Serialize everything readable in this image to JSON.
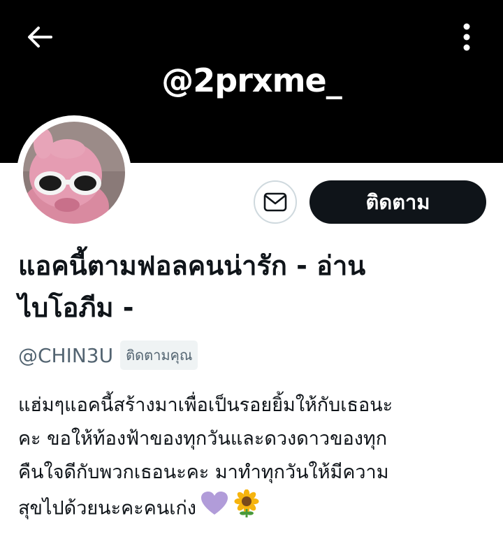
{
  "header": {
    "back_icon": "arrow-left-icon",
    "menu_icon": "more-vertical-icon",
    "banner_text": "@2prxme_",
    "banner_color": "#000000"
  },
  "actions": {
    "message_icon": "envelope-icon",
    "follow_label": "ติดตาม"
  },
  "profile": {
    "display_name_line1": "แอคนี้ตามฟอลคนน่ารัก - อ่าน",
    "display_name_line2": "ไบโอภีม -",
    "handle": "@CHIN3U",
    "follows_you_badge": "ติดตามคุณ",
    "bio": {
      "line1": "แฮ่มๆแอคนี้สร้างมาเพื่อเป็นรอยยิ้มให้กับเธอนะ",
      "line2": "คะ ขอให้ท้องฟ้าของทุกวันและดวงดาวของทุก",
      "line3": "คืนใจดีกับพวกเธอนะคะ มาทำทุกวันให้มีความ",
      "line4": "สุขไปด้วยนะคะคนเก่ง",
      "emojis": [
        "purple-heart-icon",
        "sunflower-icon"
      ]
    }
  },
  "colors": {
    "primary_text": "#0f1419",
    "secondary_text": "#536471",
    "follow_button_bg": "#0f1419",
    "badge_bg": "#eff3f4",
    "border": "#cfd9de",
    "heart": "#b19cd9",
    "sunflower_petal": "#f6b40e"
  }
}
